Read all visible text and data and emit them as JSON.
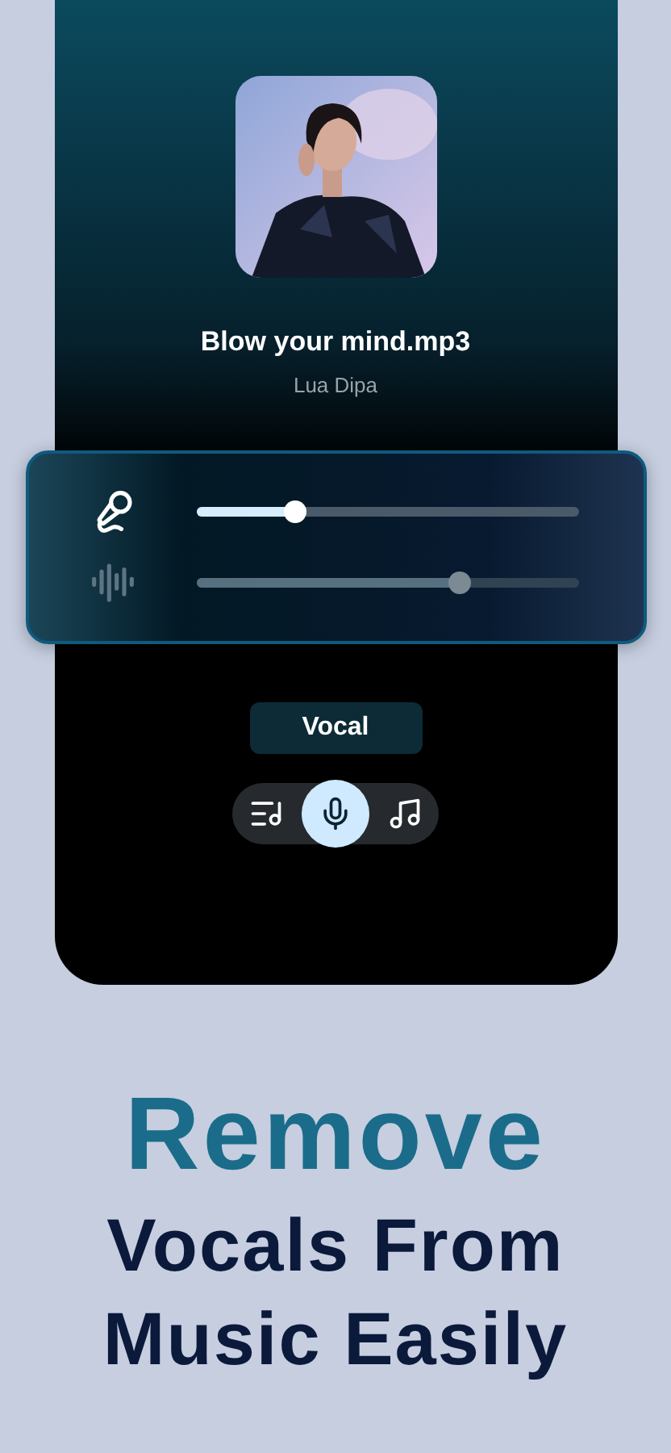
{
  "track": {
    "title": "Blow your mind.mp3",
    "artist": "Lua Dipa"
  },
  "mixer": [
    {
      "kind": "vocal",
      "level": 0.26,
      "active": true
    },
    {
      "kind": "music",
      "level": 0.69,
      "active": false
    }
  ],
  "mode_label": "Vocal",
  "modes": [
    {
      "kind": "playlist",
      "selected": false
    },
    {
      "kind": "vocal",
      "selected": true
    },
    {
      "kind": "music",
      "selected": false
    }
  ],
  "headline": {
    "accent": "Remove",
    "lines": [
      "Vocals From",
      "Music Easily"
    ]
  }
}
